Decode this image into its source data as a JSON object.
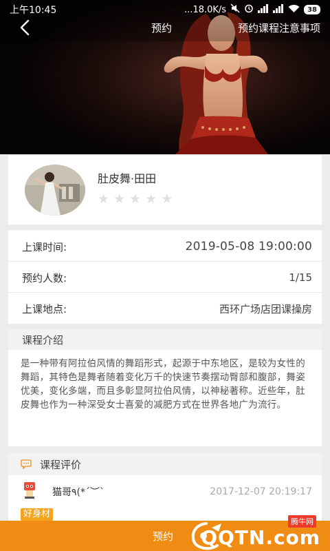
{
  "status_bar": {
    "time": "上午10:45",
    "network_speed": "...18.0K/s",
    "battery": "38",
    "icons": [
      "mute-icon",
      "alarm-icon",
      "signal-icon",
      "signal-icon",
      "wifi-icon",
      "battery-icon"
    ]
  },
  "nav": {
    "back_icon": "back-chevron-icon",
    "title": "预约",
    "notes_link": "预约课程注意事项"
  },
  "teacher": {
    "name": "肚皮舞·田田",
    "rating_stars_total": 5,
    "rating_filled": 0
  },
  "course_info": {
    "rows": [
      {
        "label": "上课时间:",
        "value": "2019-05-08 19:00:00"
      },
      {
        "label": "预约人数:",
        "value": "1/15"
      },
      {
        "label": "上课地点:",
        "value": "西环广场店团课操房"
      }
    ]
  },
  "intro": {
    "heading": "课程介绍",
    "text": "是一种带有阿拉伯风情的舞蹈形式，起源于中东地区，是较为女性的舞蹈，其特色是舞者随着变化万千的快速节奏摆动臀部和腹部，舞姿优美，变化多端，而且多彰显阿拉伯风情，以神秘著称。近些年，肚皮舞也作为一种深受女士喜爱的减肥方式在世界各地广为流行。"
  },
  "reviews": {
    "heading": "课程评价",
    "heading_icon": "chat-bubble-icon",
    "items": [
      {
        "name": "猫哥٩(*´︶`",
        "time": "2017-12-07 20:19:17",
        "tag": "好身材"
      }
    ]
  },
  "bottom_bar": {
    "label": "预约",
    "watermark_small": "腾牛网",
    "watermark_big": "QQTN.com"
  },
  "colors": {
    "accent": "#f08c14",
    "tag": "#f4a41f",
    "star_empty": "#e0e0e0",
    "background": "#ececec"
  }
}
